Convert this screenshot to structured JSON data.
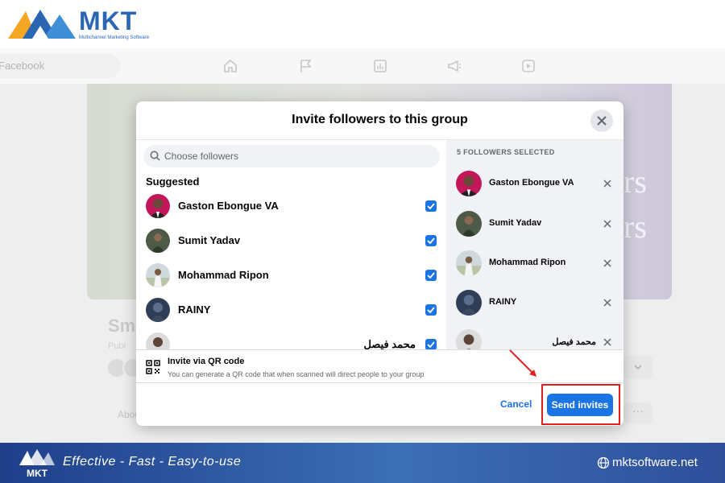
{
  "brand": {
    "name": "MKT",
    "tagline": "Multichannel Marketing Software",
    "accent": "#2b66b3"
  },
  "background_page": {
    "search_placeholder": "Facebook",
    "cover_text_line1": "rs",
    "cover_text_line2": "rs",
    "page_name": "Sma",
    "privacy": "Publ",
    "tab_about": "Abou",
    "more_label": "···"
  },
  "modal": {
    "title": "Invite followers to this group",
    "search_placeholder": "Choose followers",
    "suggested_heading": "Suggested",
    "followers": [
      {
        "name": "Gaston Ebongue VA",
        "checked": true
      },
      {
        "name": "Sumit Yadav",
        "checked": true
      },
      {
        "name": "Mohammad Ripon",
        "checked": true
      },
      {
        "name": "RAINY",
        "checked": true
      },
      {
        "name": "محمد فيصل",
        "checked": true
      }
    ],
    "selected_heading": "5 FOLLOWERS SELECTED",
    "selected": [
      {
        "name": "Gaston Ebongue VA"
      },
      {
        "name": "Sumit Yadav"
      },
      {
        "name": "Mohammad Ripon"
      },
      {
        "name": "RAINY"
      },
      {
        "name": "محمد فيصل"
      }
    ],
    "qr_title": "Invite via QR code",
    "qr_description": "You can generate a QR code that when scanned will direct people to your group",
    "cancel_label": "Cancel",
    "send_label": "Send invites",
    "primary_color": "#1b74e4",
    "highlight_color": "#e02020"
  },
  "footer": {
    "tagline": "Effective - Fast - Easy-to-use",
    "website": "mktsoftware.net"
  }
}
